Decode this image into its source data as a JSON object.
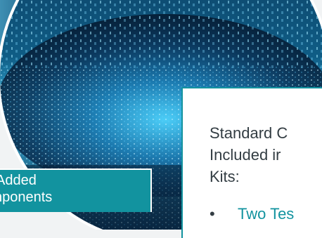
{
  "slide": {
    "added_box": {
      "line1": "Added",
      "line2": "nponents"
    },
    "standard_box": {
      "line1": "Standard C",
      "line2": "Included ir",
      "line3": "Kits:",
      "bullet_symbol": "•",
      "bullet_text": "Two Tes"
    }
  },
  "colors": {
    "accent": "#12939f",
    "text": "#333d43",
    "background": "#f1f3f4",
    "city_dark": "#061c31",
    "city_glow": "#29b4e0"
  }
}
